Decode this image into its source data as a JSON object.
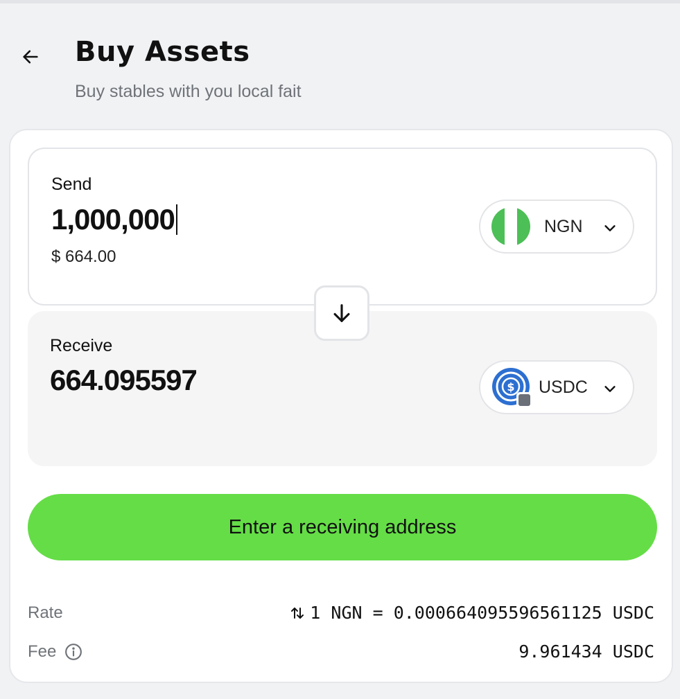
{
  "header": {
    "title": "Buy Assets",
    "subtitle": "Buy stables with you local fait"
  },
  "send": {
    "label": "Send",
    "amount": "1,000,000",
    "usd_value": "$ 664.00",
    "currency": "NGN",
    "flag_colors": [
      "#4cbf56",
      "#ffffff",
      "#4cbf56"
    ]
  },
  "receive": {
    "label": "Receive",
    "amount": "664.095597",
    "currency": "USDC"
  },
  "cta": {
    "label": "Enter a receiving address",
    "color": "#65dd47"
  },
  "details": {
    "rate_label": "Rate",
    "rate_value": "1 NGN = 0.000664095596561125 USDC",
    "fee_label": "Fee",
    "fee_value": "9.961434 USDC"
  },
  "icons": {
    "back": "arrow-left-icon",
    "swap": "arrow-down-icon",
    "chevron": "chevron-down-icon",
    "rate": "swap-vertical-icon",
    "fee": "info-icon"
  }
}
